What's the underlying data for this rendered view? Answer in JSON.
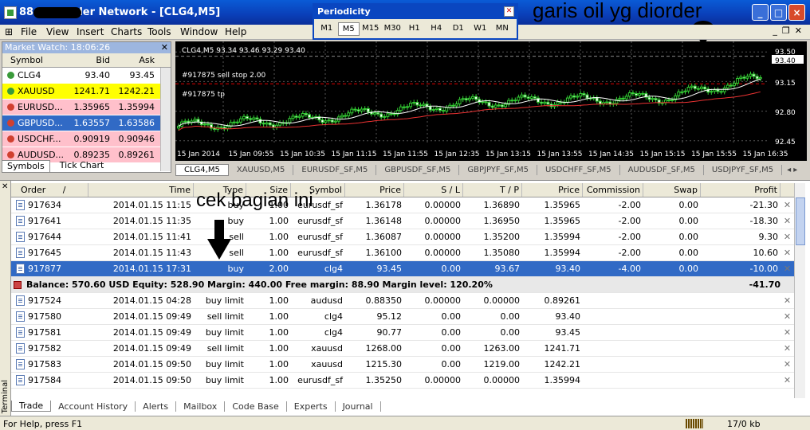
{
  "window": {
    "title": "88 RG Trader Network - [CLG4,M5]"
  },
  "annotations": {
    "top": "garis oil yg diorder",
    "middle": "cek bagian ini"
  },
  "menu": [
    "File",
    "View",
    "Insert",
    "Charts",
    "Tools",
    "Window",
    "Help"
  ],
  "periodicity": {
    "title": "Periodicity",
    "items": [
      "M1",
      "M5",
      "M15",
      "M30",
      "H1",
      "H4",
      "D1",
      "W1",
      "MN"
    ],
    "active": "M5"
  },
  "market_watch": {
    "title": "Market Watch: 18:06:26",
    "headers": [
      "Symbol",
      "Bid",
      "Ask"
    ],
    "rows": [
      {
        "symbol": "CLG4",
        "bid": "93.40",
        "ask": "93.45",
        "bg": "#ffffff",
        "dot": "#3a9a3a"
      },
      {
        "symbol": "XAUUSD",
        "bid": "1241.71",
        "ask": "1242.21",
        "bg": "#ffff00",
        "dot": "#3a9a3a"
      },
      {
        "symbol": "EURUSD...",
        "bid": "1.35965",
        "ask": "1.35994",
        "bg": "#ffc0cb",
        "dot": "#d04030"
      },
      {
        "symbol": "GBPUSD...",
        "bid": "1.63557",
        "ask": "1.63586",
        "bg": "#316ac5",
        "dot": "#d04030",
        "fg": "#ffffff"
      },
      {
        "symbol": "USDCHF...",
        "bid": "0.90919",
        "ask": "0.90946",
        "bg": "#ffc0cb",
        "dot": "#d04030"
      },
      {
        "symbol": "AUDUSD...",
        "bid": "0.89235",
        "ask": "0.89261",
        "bg": "#ffc0cb",
        "dot": "#d04030"
      }
    ],
    "tabs": [
      "Symbols",
      "Tick Chart"
    ]
  },
  "chart": {
    "header": "CLG4,M5  93.34 93.46 93.29 93.40",
    "label_sl": "#917875 sell stop 2.00",
    "label_tp": "#917875 tp",
    "price_labels": [
      "93.50",
      "93.40",
      "93.15",
      "92.80",
      "92.45"
    ],
    "current_price": "93.40",
    "time_labels": [
      "15 Jan 2014",
      "15 Jan 09:55",
      "15 Jan 10:35",
      "15 Jan 11:15",
      "15 Jan 11:55",
      "15 Jan 12:35",
      "15 Jan 13:15",
      "15 Jan 13:55",
      "15 Jan 14:35",
      "15 Jan 15:15",
      "15 Jan 15:55",
      "15 Jan 16:35"
    ]
  },
  "chart_tabs": [
    "CLG4,M5",
    "XAUUSD,M5",
    "EURUSDF_SF,M5",
    "GBPUSDF_SF,M5",
    "GBPJPYF_SF,M5",
    "USDCHFF_SF,M5",
    "AUDUSDF_SF,M5",
    "USDJPYF_SF,M5"
  ],
  "terminal": {
    "label": "Terminal",
    "headers": [
      "Order",
      "/",
      "Time",
      "Type",
      "Size",
      "Symbol",
      "Price",
      "S / L",
      "T / P",
      "Price",
      "Commission",
      "Swap",
      "Profit"
    ],
    "rows": [
      {
        "order": "917634",
        "time": "2014.01.15 11:15",
        "type": "buy",
        "size": "1.00",
        "symbol": "eurusdf_sf",
        "price": "1.36178",
        "sl": "0.00000",
        "tp": "1.36890",
        "price2": "1.35965",
        "commission": "-2.00",
        "swap": "0.00",
        "profit": "-21.30"
      },
      {
        "order": "917641",
        "time": "2014.01.15 11:35",
        "type": "buy",
        "size": "1.00",
        "symbol": "eurusdf_sf",
        "price": "1.36148",
        "sl": "0.00000",
        "tp": "1.36950",
        "price2": "1.35965",
        "commission": "-2.00",
        "swap": "0.00",
        "profit": "-18.30"
      },
      {
        "order": "917644",
        "time": "2014.01.15 11:41",
        "type": "sell",
        "size": "1.00",
        "symbol": "eurusdf_sf",
        "price": "1.36087",
        "sl": "0.00000",
        "tp": "1.35200",
        "price2": "1.35994",
        "commission": "-2.00",
        "swap": "0.00",
        "profit": "9.30"
      },
      {
        "order": "917645",
        "time": "2014.01.15 11:43",
        "type": "sell",
        "size": "1.00",
        "symbol": "eurusdf_sf",
        "price": "1.36100",
        "sl": "0.00000",
        "tp": "1.35080",
        "price2": "1.35994",
        "commission": "-2.00",
        "swap": "0.00",
        "profit": "10.60"
      },
      {
        "order": "917877",
        "time": "2014.01.15 17:31",
        "type": "buy",
        "size": "2.00",
        "symbol": "clg4",
        "price": "93.45",
        "sl": "0.00",
        "tp": "93.67",
        "price2": "93.40",
        "commission": "-4.00",
        "swap": "0.00",
        "profit": "-10.00",
        "selected": true
      },
      {
        "balance": true,
        "text": "Balance: 570.60 USD  Equity: 528.90  Margin: 440.00  Free margin: 88.90  Margin level: 120.20%",
        "profit": "-41.70"
      },
      {
        "order": "917524",
        "time": "2014.01.15 04:28",
        "type": "buy limit",
        "size": "1.00",
        "symbol": "audusd",
        "price": "0.88350",
        "sl": "0.00000",
        "tp": "0.00000",
        "price2": "0.89261",
        "commission": "",
        "swap": "",
        "profit": ""
      },
      {
        "order": "917580",
        "time": "2014.01.15 09:49",
        "type": "sell limit",
        "size": "1.00",
        "symbol": "clg4",
        "price": "95.12",
        "sl": "0.00",
        "tp": "0.00",
        "price2": "93.40",
        "commission": "",
        "swap": "",
        "profit": ""
      },
      {
        "order": "917581",
        "time": "2014.01.15 09:49",
        "type": "buy limit",
        "size": "1.00",
        "symbol": "clg4",
        "price": "90.77",
        "sl": "0.00",
        "tp": "0.00",
        "price2": "93.45",
        "commission": "",
        "swap": "",
        "profit": ""
      },
      {
        "order": "917582",
        "time": "2014.01.15 09:49",
        "type": "sell limit",
        "size": "1.00",
        "symbol": "xauusd",
        "price": "1268.00",
        "sl": "0.00",
        "tp": "1263.00",
        "price2": "1241.71",
        "commission": "",
        "swap": "",
        "profit": ""
      },
      {
        "order": "917583",
        "time": "2014.01.15 09:50",
        "type": "buy limit",
        "size": "1.00",
        "symbol": "xauusd",
        "price": "1215.30",
        "sl": "0.00",
        "tp": "1219.00",
        "price2": "1242.21",
        "commission": "",
        "swap": "",
        "profit": ""
      },
      {
        "order": "917584",
        "time": "2014.01.15 09:50",
        "type": "buy limit",
        "size": "1.00",
        "symbol": "eurusdf_sf",
        "price": "1.35250",
        "sl": "0.00000",
        "tp": "0.00000",
        "price2": "1.35994",
        "commission": "",
        "swap": "",
        "profit": ""
      }
    ],
    "tabs": [
      "Trade",
      "Account History",
      "Alerts",
      "Mailbox",
      "Code Base",
      "Experts",
      "Journal"
    ],
    "active_tab": "Trade"
  },
  "status": {
    "help": "For Help, press F1",
    "traffic": "17/0 kb"
  }
}
